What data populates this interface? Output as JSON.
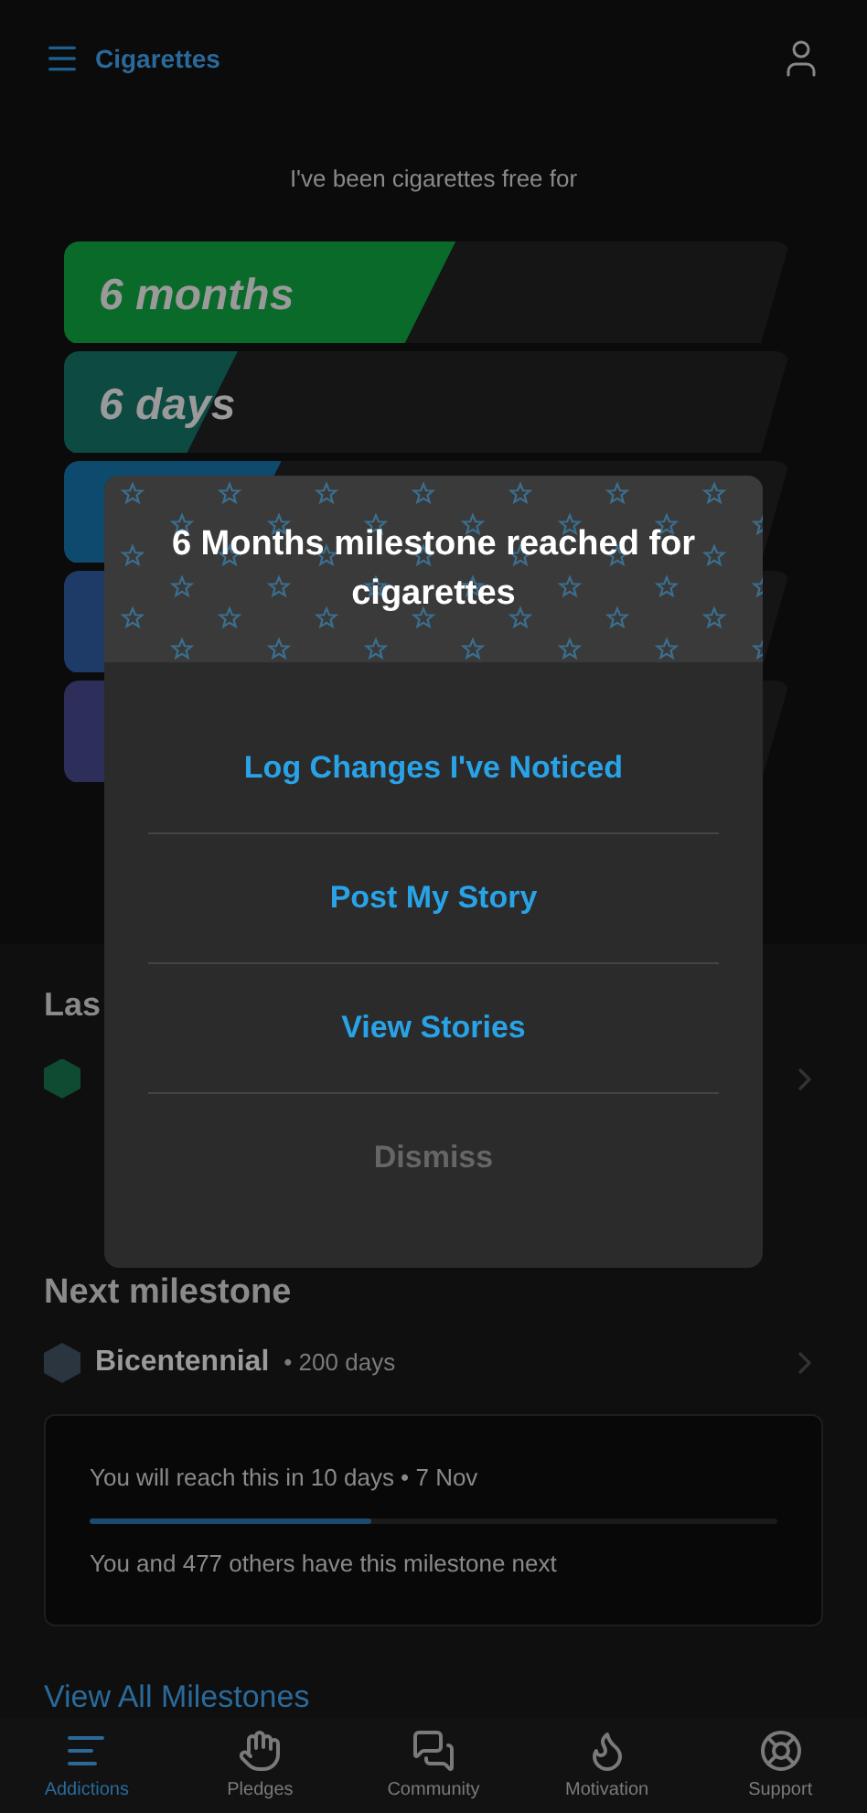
{
  "header": {
    "title": "Cigarettes"
  },
  "subtitle": "I've been cigarettes free for",
  "counters": [
    {
      "label": "6 months",
      "level": 0.54,
      "color": "#0a6a2a"
    },
    {
      "label": "6 days",
      "level": 0.24,
      "color": "#0c4a42"
    },
    {
      "color": "#0e4a6e"
    },
    {
      "color": "#1e3a66"
    },
    {
      "color": "#2d2f5a"
    }
  ],
  "last_section": {
    "title": "Las"
  },
  "next_section": {
    "title": "Next milestone",
    "milestone": {
      "name": "Bicentennial",
      "duration": "• 200 days"
    },
    "card": {
      "reach_text": "You will reach this in 10 days • 7 Nov",
      "level": 0.41,
      "others_text": "You and 477 others have this milestone next"
    }
  },
  "view_all_link": "View All Milestones",
  "dialog": {
    "title": "6 Months milestone reached for cigarettes",
    "actions": [
      {
        "label": "Log Changes I've Noticed",
        "kind": "primary"
      },
      {
        "label": "Post My Story",
        "kind": "primary"
      },
      {
        "label": "View Stories",
        "kind": "primary"
      },
      {
        "label": "Dismiss",
        "kind": "muted"
      }
    ]
  },
  "nav": [
    {
      "label": "Addictions",
      "selected": true
    },
    {
      "label": "Pledges",
      "selected": false
    },
    {
      "label": "Community",
      "selected": false
    },
    {
      "label": "Motivation",
      "selected": false
    },
    {
      "label": "Support",
      "selected": false
    }
  ]
}
